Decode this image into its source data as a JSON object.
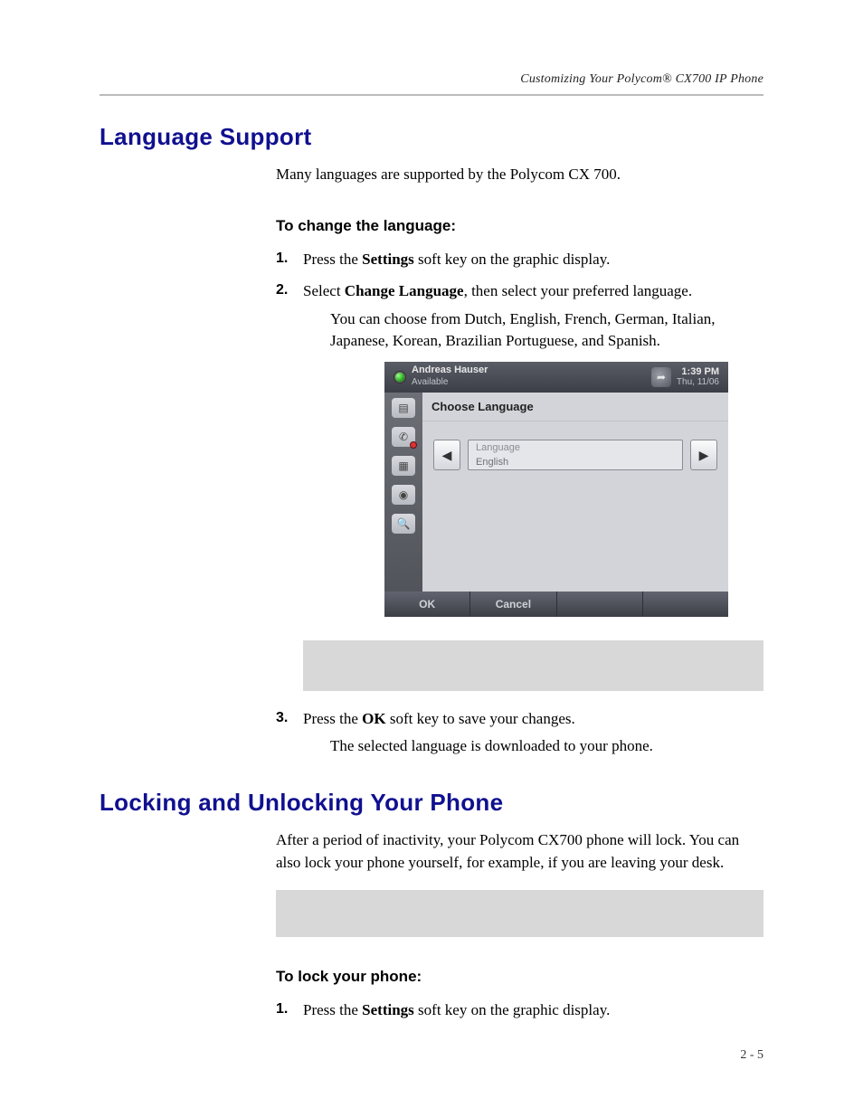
{
  "header": {
    "right": "Customizing Your Polycom® CX700 IP Phone"
  },
  "section1": {
    "title": "Language Support",
    "intro": "Many languages are supported by the Polycom CX 700.",
    "subhead": "To change the language:",
    "step1_num": "1.",
    "step1_a": "Press the ",
    "step1_bold": "Settings",
    "step1_b": " soft key on the graphic display.",
    "step2_num": "2.",
    "step2_a": "Select ",
    "step2_bold": "Change Language",
    "step2_b": ", then select your preferred language.",
    "step2_note": "You can choose from Dutch, English, French, German, Italian, Japanese, Korean, Brazilian Portuguese, and Spanish.",
    "step3_num": "3.",
    "step3_a": "Press the ",
    "step3_bold": "OK",
    "step3_b": " soft key to save your changes.",
    "step3_note": "The selected language is downloaded to your phone."
  },
  "phone": {
    "user": "Andreas Hauser",
    "presence": "Available",
    "time": "1:39 PM",
    "date": "Thu, 11/06",
    "screen_title": "Choose Language",
    "field_label": "Language",
    "field_value": "English",
    "soft_ok": "OK",
    "soft_cancel": "Cancel",
    "arrow_left": "◀",
    "arrow_right": "▶",
    "fwd_glyph": "➦",
    "ico1": "▤",
    "ico2": "✆",
    "ico3": "▦",
    "ico4": "◉",
    "ico5": "🔍"
  },
  "section2": {
    "title": "Locking and Unlocking Your Phone",
    "intro": "After a period of inactivity, your Polycom CX700 phone will lock. You can also lock your phone yourself, for example, if you are leaving your desk.",
    "subhead": "To lock your phone:",
    "step1_num": "1.",
    "step1_a": "Press the ",
    "step1_bold": "Settings",
    "step1_b": " soft key on the graphic display."
  },
  "footer": {
    "pagenum": "2 - 5"
  }
}
